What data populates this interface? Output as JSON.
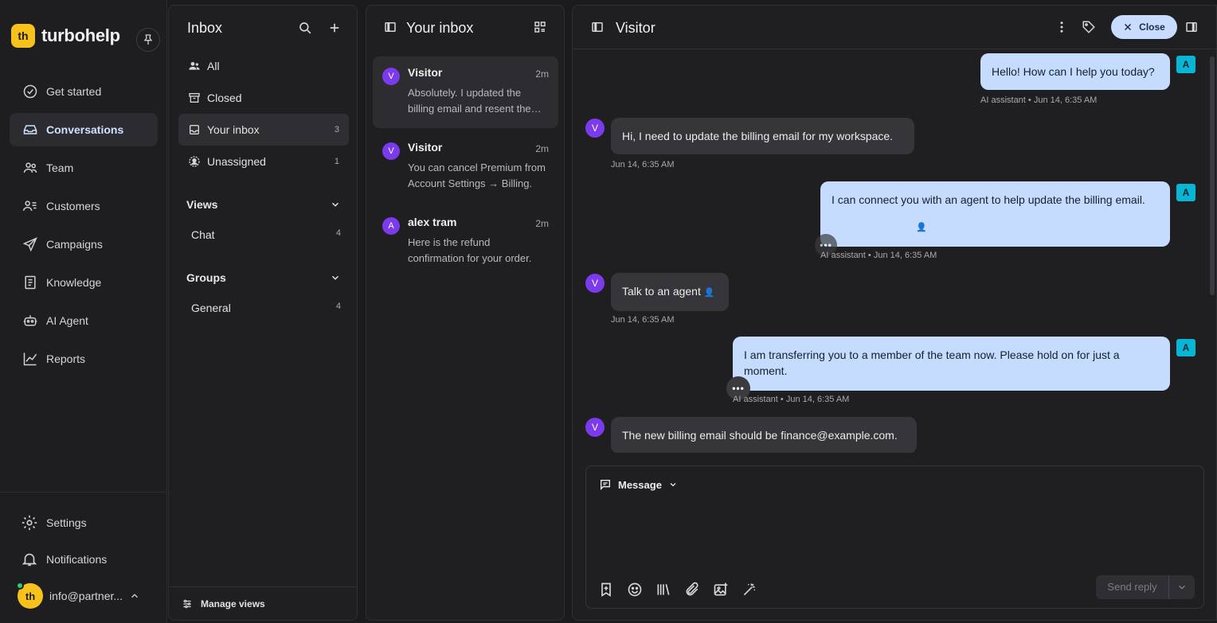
{
  "brand": {
    "logo_text": "th",
    "name": "turbohelp"
  },
  "nav": {
    "items": [
      {
        "label": "Get started",
        "icon": "check-circle-icon"
      },
      {
        "label": "Conversations",
        "icon": "inbox-tray-icon",
        "active": true
      },
      {
        "label": "Team",
        "icon": "team-icon"
      },
      {
        "label": "Customers",
        "icon": "customers-icon"
      },
      {
        "label": "Campaigns",
        "icon": "send-icon"
      },
      {
        "label": "Knowledge",
        "icon": "book-icon"
      },
      {
        "label": "AI Agent",
        "icon": "robot-icon"
      },
      {
        "label": "Reports",
        "icon": "chart-icon"
      }
    ],
    "settings_label": "Settings",
    "notifications_label": "Notifications",
    "account": {
      "avatar_text": "th",
      "email": "info@partner..."
    }
  },
  "inbox_panel": {
    "title": "Inbox",
    "items": [
      {
        "label": "All",
        "count": ""
      },
      {
        "label": "Closed",
        "count": ""
      },
      {
        "label": "Your inbox",
        "count": "3"
      },
      {
        "label": "Unassigned",
        "count": "1"
      }
    ],
    "views": {
      "title": "Views",
      "items": [
        {
          "label": "Chat",
          "count": "4"
        }
      ]
    },
    "groups": {
      "title": "Groups",
      "items": [
        {
          "label": "General",
          "count": "4"
        }
      ]
    },
    "manage_label": "Manage views"
  },
  "list_panel": {
    "title": "Your inbox",
    "conversations": [
      {
        "avatar": "V",
        "name": "Visitor",
        "time": "2m",
        "snippet": "Absolutely. I updated the billing email and resent the latest invoice."
      },
      {
        "avatar": "V",
        "name": "Visitor",
        "time": "2m",
        "snippet": "You can cancel Premium from Account Settings → Billing."
      },
      {
        "avatar": "A",
        "name": "alex tram",
        "time": "2m",
        "snippet": "Here is the refund confirmation for your order."
      }
    ]
  },
  "chat": {
    "title": "Visitor",
    "close_label": "Close",
    "messages": [
      {
        "from": "bot",
        "avatar": "A",
        "text": "Hello! How can I help you today?",
        "meta": "AI assistant • Jun 14, 6:35 AM"
      },
      {
        "from": "visitor",
        "avatar": "V",
        "text": "Hi, I need to update the billing email for my workspace.",
        "meta": "Jun 14, 6:35 AM"
      },
      {
        "from": "bot",
        "avatar": "A",
        "text": "I can connect you with an agent to help update the billing email.",
        "meta": "AI assistant • Jun 14, 6:35 AM"
      },
      {
        "from": "visitor",
        "avatar": "V",
        "text": "Talk to an agent",
        "meta": "Jun 14, 6:35 AM"
      },
      {
        "from": "bot",
        "avatar": "A",
        "text": "I am transferring you to a member of the team now. Please hold on for just a moment.",
        "meta": "AI assistant • Jun 14, 6:35 AM"
      },
      {
        "from": "visitor",
        "avatar": "V",
        "text": "The new billing email should be finance@example.com.",
        "meta": ""
      }
    ],
    "typing_glyph": "•••",
    "person_glyph": "👤",
    "composer": {
      "mode_label": "Message",
      "send_label": "Send reply"
    }
  }
}
